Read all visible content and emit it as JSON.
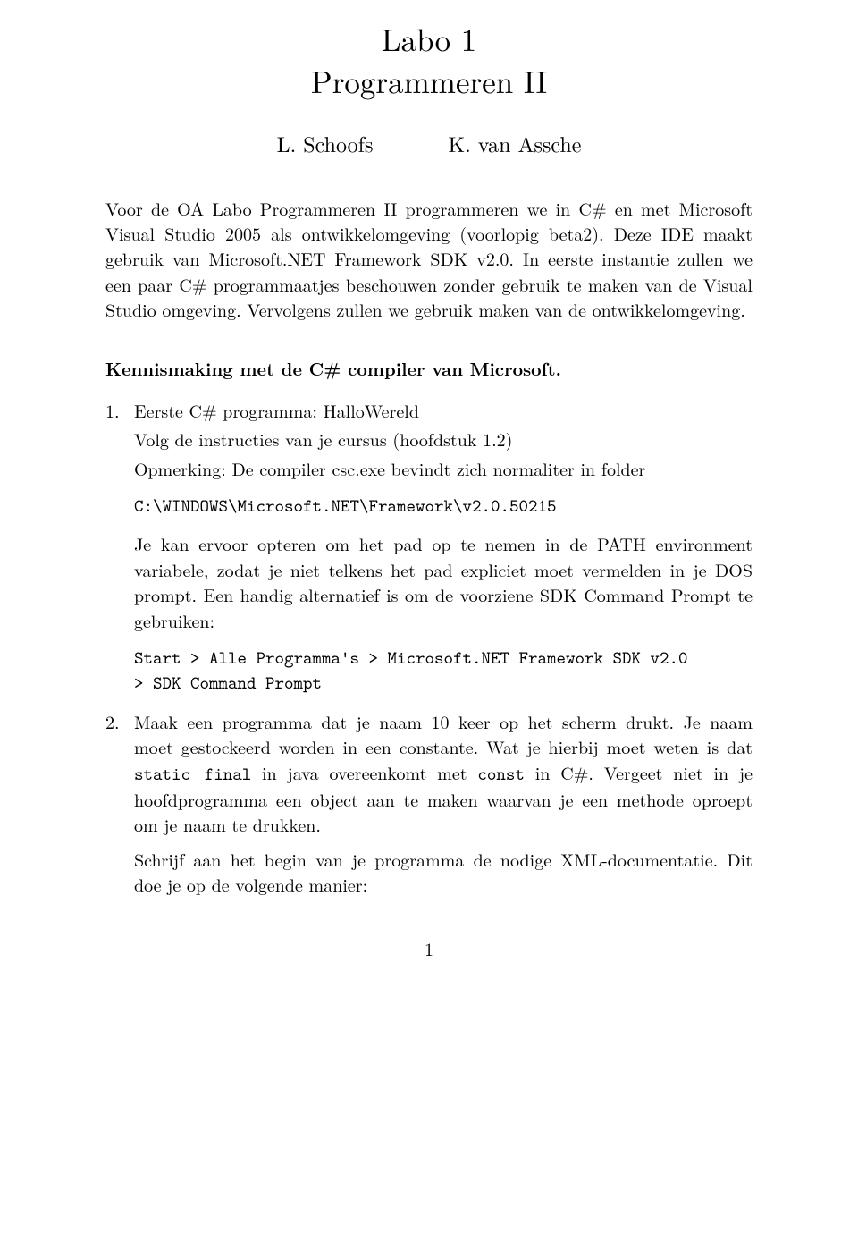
{
  "title": {
    "line1": "Labo 1",
    "line2": "Programmeren II"
  },
  "authors": {
    "left": "L. Schoofs",
    "right": "K. van Assche"
  },
  "intro": "Voor de OA Labo Programmeren II programmeren we in C# en met Microsoft Visual Studio 2005 als ontwikkelomgeving (voorlopig beta2). Deze IDE maakt gebruik van Microsoft.NET Framework SDK v2.0. In eerste instantie zullen we een paar C# programmaatjes beschouwen zonder gebruik te maken van de Visual Studio omgeving. Vervolgens zullen we gebruik maken van de ontwikkelomgeving.",
  "section_heading": "Kennismaking met de C# compiler van Microsoft.",
  "item1": {
    "line1": "Eerste C# programma: HalloWereld",
    "line2": "Volg de instructies van je cursus (hoofdstuk 1.2)",
    "line3": "Opmerking: De compiler csc.exe bevindt zich normaliter in folder",
    "code1": "C:\\WINDOWS\\Microsoft.NET\\Framework\\v2.0.50215",
    "para2": "Je kan ervoor opteren om het pad op te nemen in de PATH environment variabele, zodat je niet telkens het pad expliciet moet vermelden in je DOS prompt. Een handig alternatief is om de voorziene SDK Command Prompt te gebruiken:",
    "code2": "Start > Alle Programma's > Microsoft.NET Framework SDK v2.0\n> SDK Command Prompt"
  },
  "item2": {
    "para1_pre": "Maak een programma dat je naam 10 keer op het scherm drukt. Je naam moet gestockeerd worden in een constante. Wat je hierbij moet weten is dat ",
    "tt1": "static final",
    "para1_mid": " in java overeenkomt met ",
    "tt2": "const",
    "para1_post": " in C#. Vergeet niet in je hoofdprogramma een object aan te maken waarvan je een methode oproept om je naam te drukken.",
    "para2": "Schrijf aan het begin van je programma de nodige XML-documentatie. Dit doe je op de volgende manier:"
  },
  "page_number": "1"
}
